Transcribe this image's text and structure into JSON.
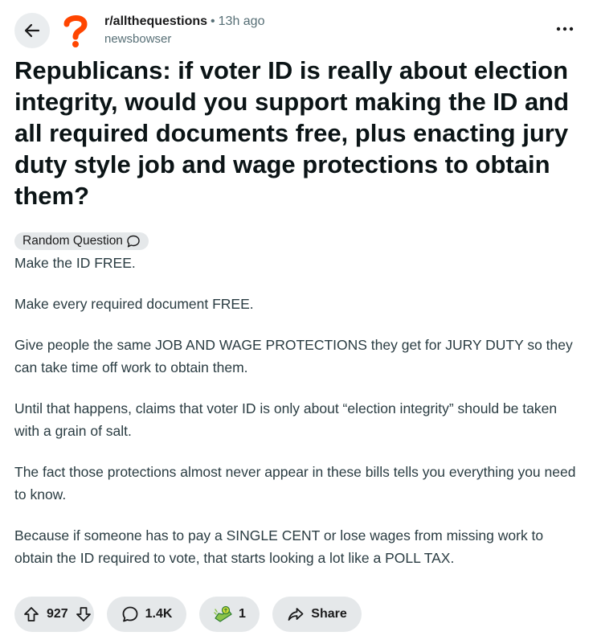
{
  "header": {
    "subreddit": "r/allthequestions",
    "separator": "•",
    "time_ago": "13h ago",
    "author": "newsbowser"
  },
  "post": {
    "title": "Republicans: if voter ID is really about election integrity, would you support making the ID and all required documents free, plus enacting jury duty style job and wage protections to obtain them?",
    "flair": "Random Question",
    "paragraphs": [
      "Make the ID FREE.",
      "Make every required document FREE.",
      "Give people the same JOB AND WAGE PROTECTIONS they get for JURY DUTY so they can take time off work to obtain them.",
      "Until that happens, claims that voter ID is only about “election integrity” should be taken with a grain of salt.",
      "The fact those protections almost never appear in these bills tells you everything you need to know.",
      "Because if someone has to pay a SINGLE CENT or lose wages from missing work to obtain the ID required to vote, that starts looking a lot like a POLL TAX."
    ]
  },
  "actions": {
    "upvotes": "927",
    "comments": "1.4K",
    "awards": "1",
    "share_label": "Share"
  },
  "icons": {
    "back": "arrow-left-icon",
    "subreddit": "question-mark-icon",
    "more": "ellipsis-icon",
    "flair": "speech-bubble-icon",
    "upvote": "arrow-up-icon",
    "downvote": "arrow-down-icon",
    "comment": "comment-bubble-icon",
    "award": "award-icon",
    "share": "share-arrow-icon"
  },
  "colors": {
    "accent_orange": "#ff4500",
    "muted_text": "#576f76",
    "pill_background": "#e5e8ea"
  }
}
